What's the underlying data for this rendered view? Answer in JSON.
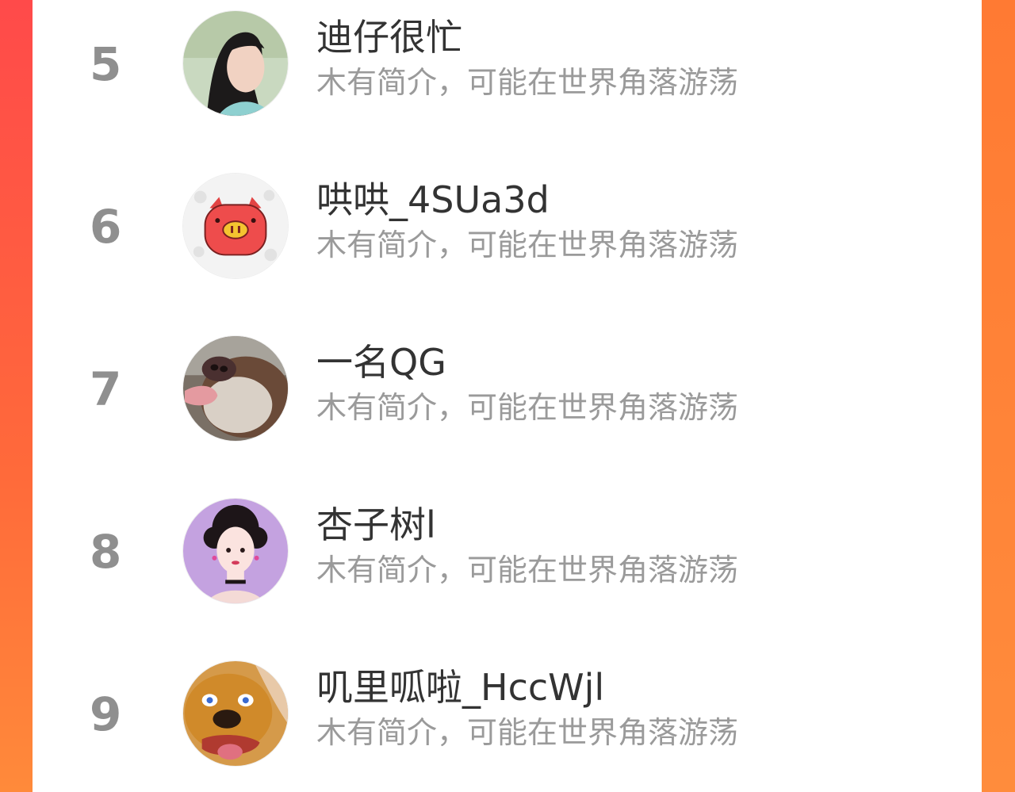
{
  "ranking": {
    "rows": [
      {
        "rank": "5",
        "name": "迪仔很忙",
        "bio": "木有简介，可能在世界角落游荡",
        "avatar_icon": "woman-portrait-avatar"
      },
      {
        "rank": "6",
        "name": "哄哄_4SUa3d",
        "bio": "木有简介，可能在世界角落游荡",
        "avatar_icon": "pig-cartoon-avatar"
      },
      {
        "rank": "7",
        "name": "一名QG",
        "bio": "木有简介，可能在世界角落游荡",
        "avatar_icon": "dog-tongue-avatar"
      },
      {
        "rank": "8",
        "name": "杏子树l",
        "bio": "木有简介，可能在世界角落游荡",
        "avatar_icon": "illustrated-woman-avatar"
      },
      {
        "rank": "9",
        "name": "叽里呱啦_HccWjl",
        "bio": "木有简介，可能在世界角落游荡",
        "avatar_icon": "golden-dog-avatar"
      }
    ]
  },
  "colors": {
    "background_left": "#ff4a4a",
    "background_right": "#ff8a3a",
    "panel": "#ffffff",
    "rank_text": "#8f8f8f",
    "name_text": "#333333",
    "bio_text": "#9a9a9a"
  }
}
